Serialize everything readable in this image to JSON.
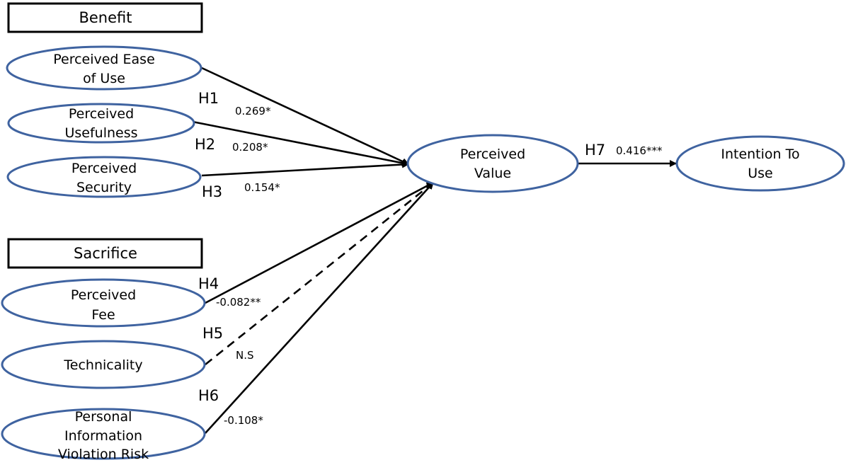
{
  "groups": {
    "benefit": "Benefit",
    "sacrifice": "Sacrifice"
  },
  "constructs": {
    "peou": [
      "Perceived  Ease",
      "of Use"
    ],
    "pu": [
      "Perceived",
      "Usefulness"
    ],
    "ps": [
      "Perceived",
      "Security"
    ],
    "pf": [
      "Perceived",
      "Fee"
    ],
    "tech": [
      "Technicality"
    ],
    "pivr": [
      "Personal",
      "Information",
      "Violation  Risk"
    ],
    "pv": [
      "Perceived",
      "Value"
    ],
    "itu": [
      "Intention  To",
      "Use"
    ]
  },
  "paths": [
    {
      "hypothesis": "H1",
      "coefficient": "0.269*",
      "style": "solid"
    },
    {
      "hypothesis": "H2",
      "coefficient": "0.208*",
      "style": "solid"
    },
    {
      "hypothesis": "H3",
      "coefficient": "0.154*",
      "style": "solid"
    },
    {
      "hypothesis": "H4",
      "coefficient": "-0.082**",
      "style": "solid"
    },
    {
      "hypothesis": "H5",
      "coefficient": "N.S",
      "style": "dashed"
    },
    {
      "hypothesis": "H6",
      "coefficient": "-0.108*",
      "style": "solid"
    },
    {
      "hypothesis": "H7",
      "coefficient": "0.416***",
      "style": "solid"
    }
  ],
  "colors": {
    "ellipse_stroke": "#3f63a0",
    "line": "#000000"
  }
}
